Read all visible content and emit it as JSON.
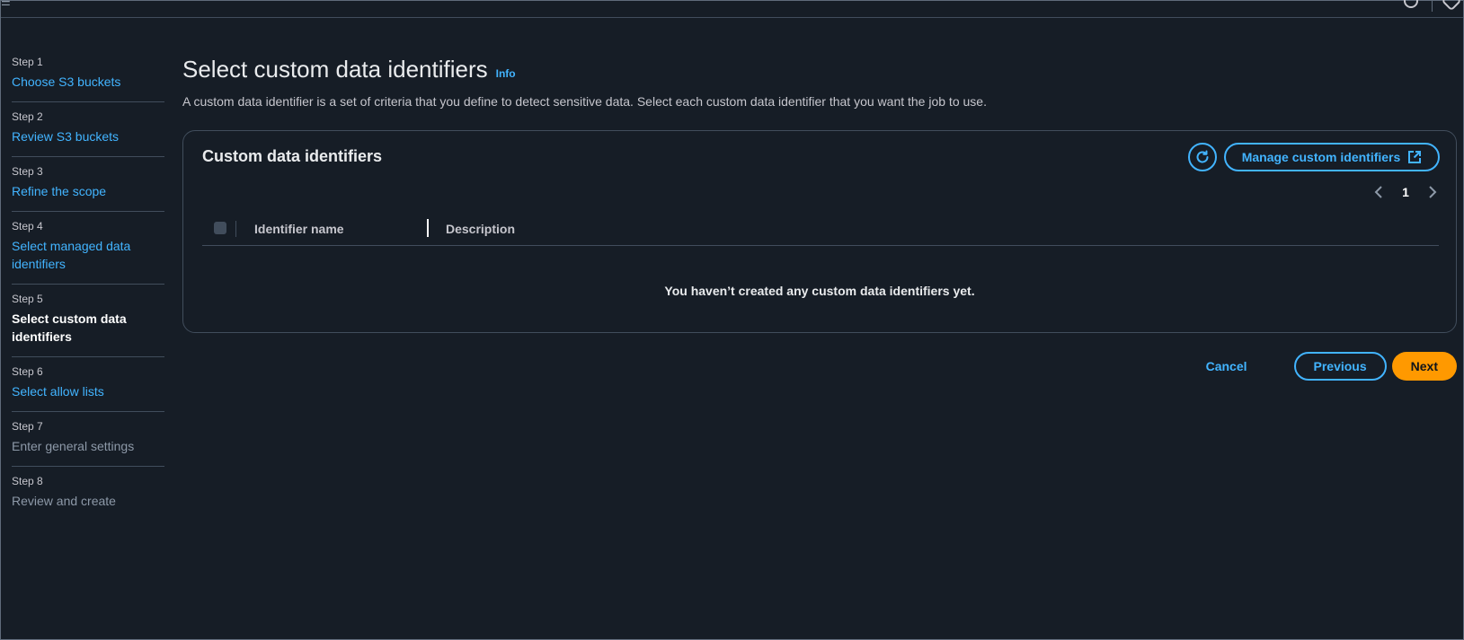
{
  "colors": {
    "background": "#161d26",
    "link": "#42b4ff",
    "primary_button": "#ff9900",
    "border": "#414d5c"
  },
  "steps": [
    {
      "num": "Step 1",
      "label": "Choose S3 buckets",
      "state": "link"
    },
    {
      "num": "Step 2",
      "label": "Review S3 buckets",
      "state": "link"
    },
    {
      "num": "Step 3",
      "label": "Refine the scope",
      "state": "link"
    },
    {
      "num": "Step 4",
      "label": "Select managed data identifiers",
      "state": "link"
    },
    {
      "num": "Step 5",
      "label": "Select custom data identifiers",
      "state": "current"
    },
    {
      "num": "Step 6",
      "label": "Select allow lists",
      "state": "link"
    },
    {
      "num": "Step 7",
      "label": "Enter general settings",
      "state": "disabled"
    },
    {
      "num": "Step 8",
      "label": "Review and create",
      "state": "disabled"
    }
  ],
  "page": {
    "title": "Select custom data identifiers",
    "info": "Info",
    "description": "A custom data identifier is a set of criteria that you define to detect sensitive data. Select each custom data identifier that you want the job to use."
  },
  "panel": {
    "title": "Custom data identifiers",
    "refresh_icon": "refresh-icon",
    "manage_label": "Manage custom identifiers",
    "manage_icon": "external-link-icon",
    "page_number": "1",
    "columns": [
      "Identifier name",
      "Description"
    ],
    "empty_message": "You haven’t created any custom data identifiers yet."
  },
  "actions": {
    "cancel": "Cancel",
    "previous": "Previous",
    "next": "Next"
  }
}
